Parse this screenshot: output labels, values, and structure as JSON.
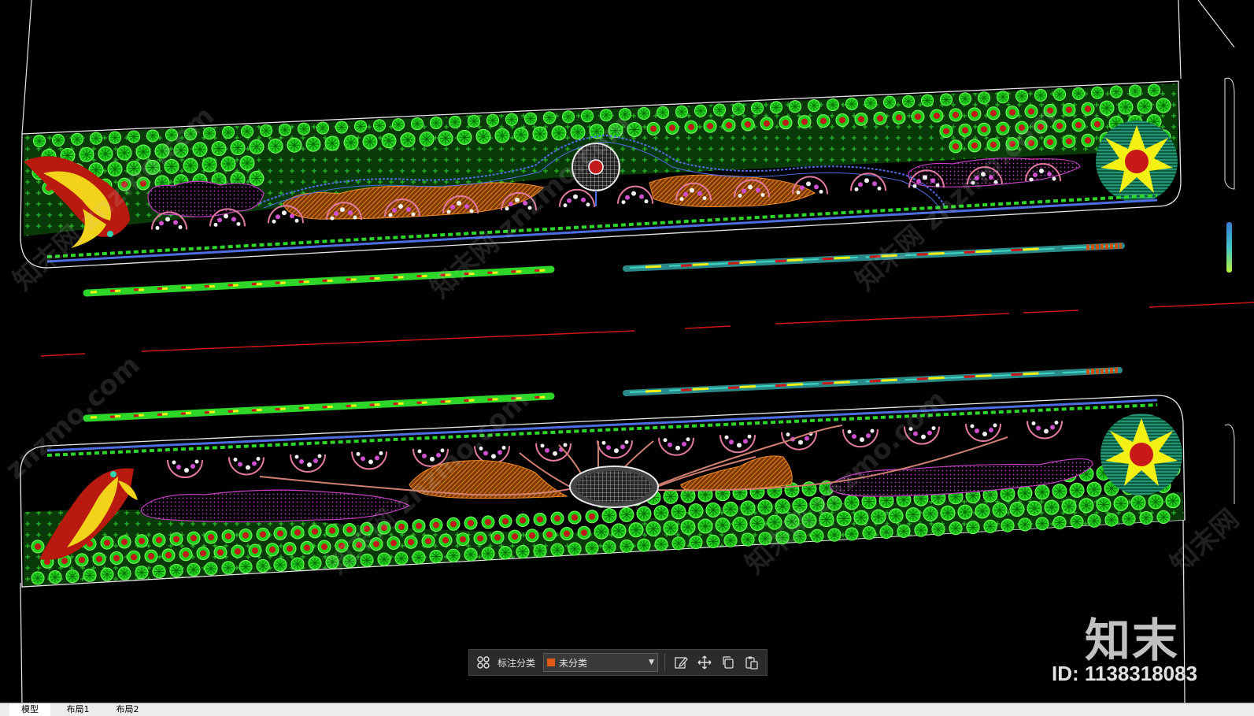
{
  "toolbar": {
    "annotation_label": "标注分类",
    "category_value": "未分类",
    "category_color": "#e05a1a",
    "icons": [
      "grid-icon",
      "edit-icon",
      "move-icon",
      "copy-icon",
      "paste-icon"
    ]
  },
  "watermark": {
    "brand": "知末",
    "id_text": "ID: 1138318083"
  },
  "tabs": [
    {
      "label": "模型",
      "active": true
    },
    {
      "label": "布局1",
      "active": false
    },
    {
      "label": "布局2",
      "active": false
    }
  ],
  "colors": {
    "background": "#000000",
    "tree_green": "#22e61c",
    "shrub_red": "#d81e1e",
    "path_blue": "#4e6de0",
    "mulch_orange": "#c86414",
    "flower_magenta": "#c040c0",
    "sun_yellow": "#f5f014",
    "road_red": "#d01515"
  }
}
